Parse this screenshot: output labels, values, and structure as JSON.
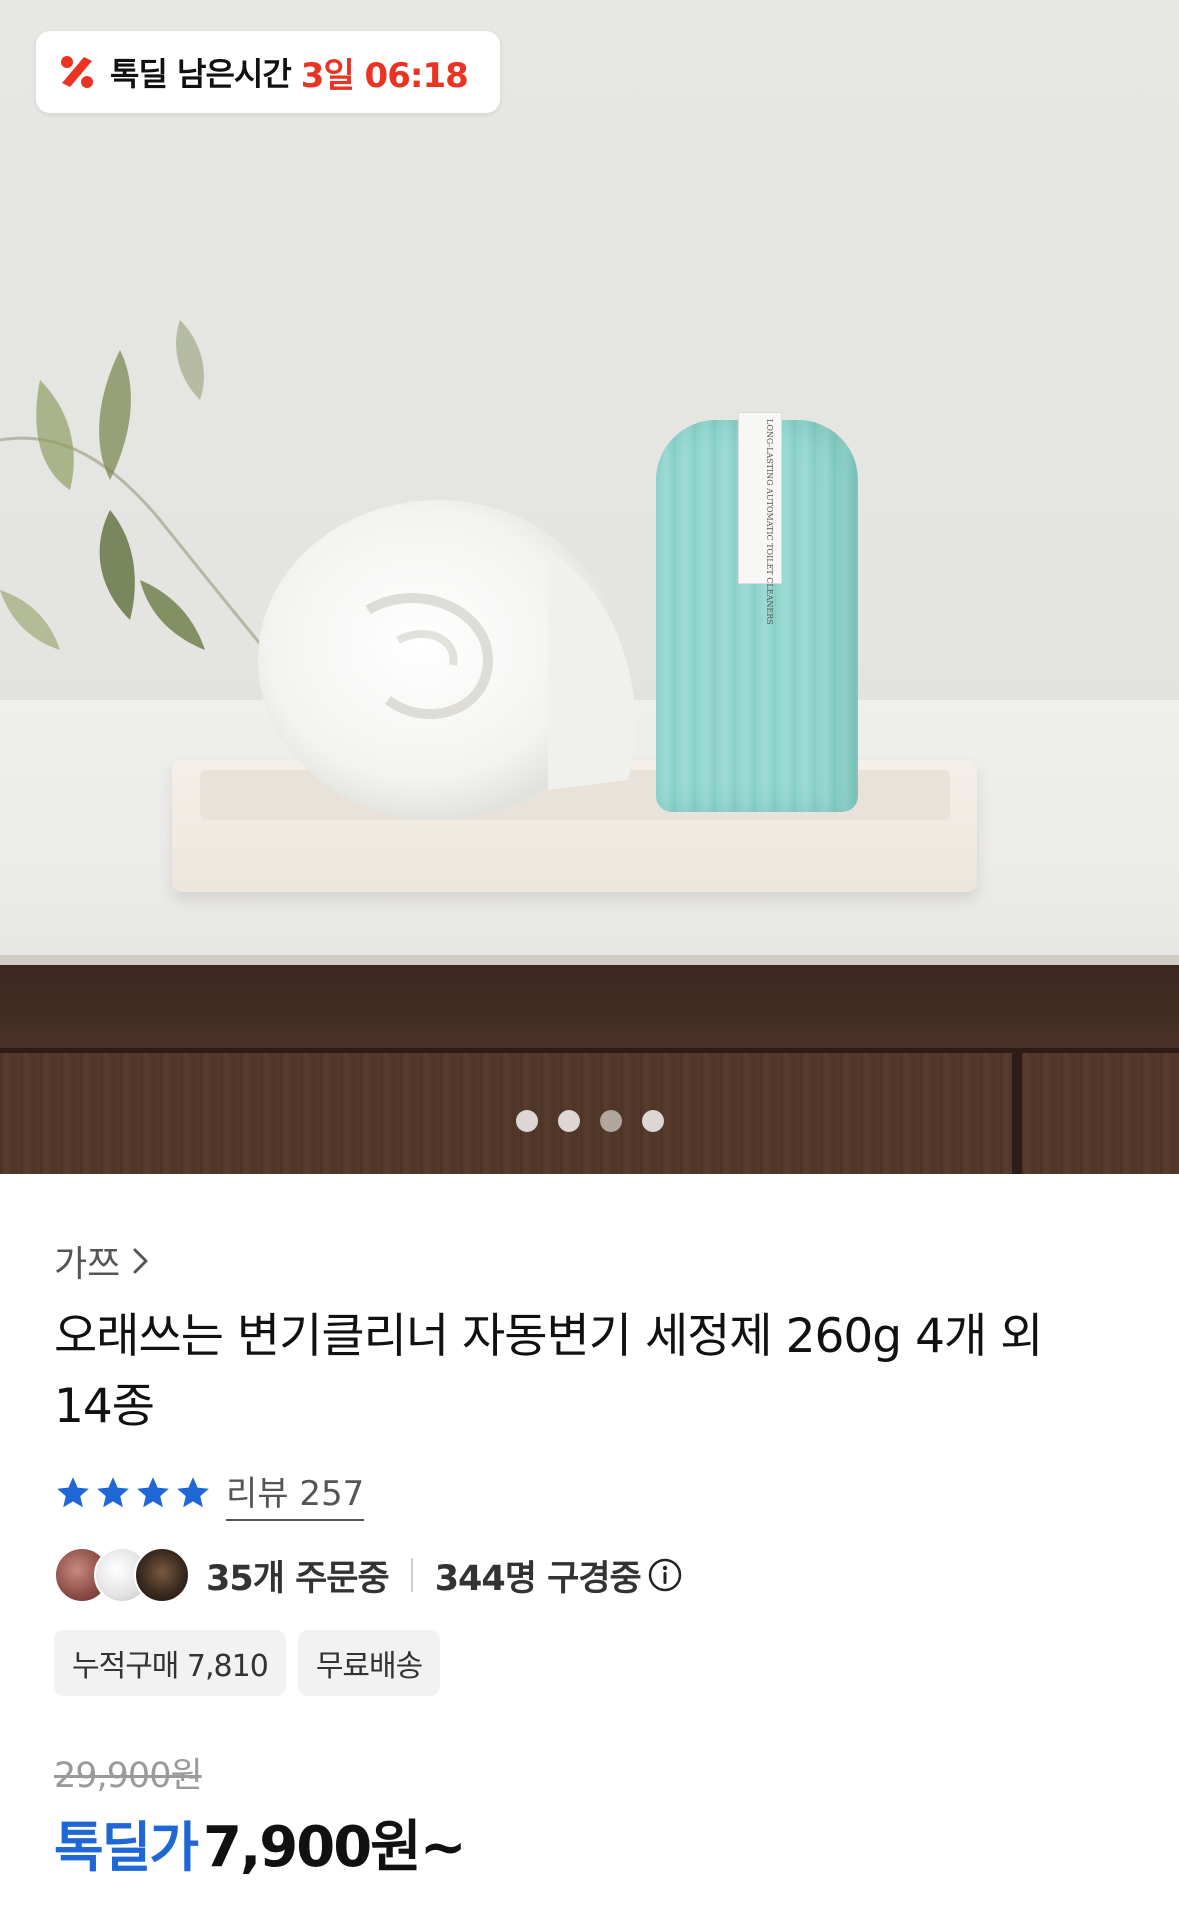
{
  "deal_timer": {
    "icon": "deal-percent-icon",
    "label": "톡딜 남은시간",
    "remaining": "3일 06:18",
    "accent_color": "#ea3323"
  },
  "product_image": {
    "carousel_dots": 4,
    "active_dot_index": 2,
    "bottle_label_text": "LONG-LASTING AUTOMATIC TOILET CLEANERS"
  },
  "product": {
    "brand": "가쯔",
    "brand_arrow_icon": "chevron-right-icon",
    "title": "오래쓰는 변기클리너 자동변기 세정제 260g 4개 외 14종"
  },
  "rating": {
    "stars": 4,
    "star_color": "#1f66d6",
    "review_label": "리뷰 257"
  },
  "social_proof": {
    "orders": "35개 주문중",
    "viewers": "344명 구경중",
    "info_icon": "info-icon"
  },
  "tags": [
    {
      "label": "누적구매 7,810"
    },
    {
      "label": "무료배송"
    }
  ],
  "price": {
    "original": "29,900원",
    "label": "톡딜가",
    "value": "7,900원~",
    "label_color": "#1f66d6"
  }
}
